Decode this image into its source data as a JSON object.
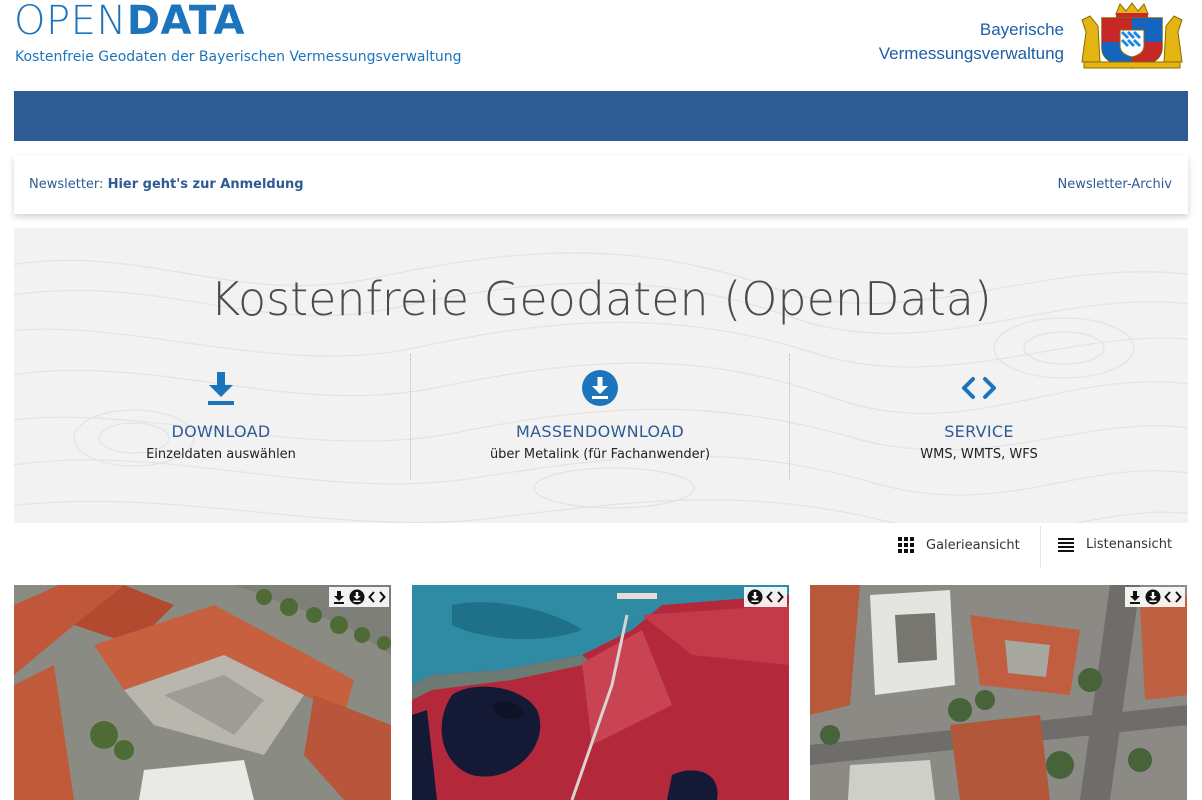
{
  "header": {
    "logo_thin": "OPEN",
    "logo_bold": "DATA",
    "tagline": "Kostenfreie Geodaten der Bayerischen Vermessungsverwaltung",
    "agency_line1": "Bayerische",
    "agency_line2": "Vermessungsverwaltung",
    "crest_icon": "bavarian-coat-of-arms"
  },
  "colors": {
    "brand_blue": "#1c75bc",
    "nav_blue": "#2e5b94",
    "hero_bg": "#f2f2f2"
  },
  "newsletter": {
    "label": "Newsletter:",
    "link": "Hier geht's zur Anmeldung",
    "archive": "Newsletter-Archiv"
  },
  "hero": {
    "title": "Kostenfreie Geodaten (OpenData)",
    "columns": [
      {
        "icon": "download-icon",
        "title": "DOWNLOAD",
        "subtitle": "Einzeldaten auswählen"
      },
      {
        "icon": "download-circle-icon",
        "title": "MASSENDOWNLOAD",
        "subtitle": "über Metalink (für Fachanwender)"
      },
      {
        "icon": "code-icon",
        "title": "SERVICE",
        "subtitle": "WMS, WMTS, WFS"
      }
    ]
  },
  "view_switch": {
    "gallery": "Galerieansicht",
    "list": "Listenansicht"
  },
  "gallery": {
    "cards": [
      {
        "image": "aerial-photo-orthophoto",
        "badges": [
          "download-icon",
          "download-circle-icon",
          "code-icon"
        ]
      },
      {
        "image": "color-infrared-aerial-photo",
        "badges": [
          "download-circle-icon",
          "code-icon"
        ]
      },
      {
        "image": "aerial-photo-city",
        "badges": [
          "download-icon",
          "download-circle-icon",
          "code-icon"
        ]
      }
    ]
  }
}
